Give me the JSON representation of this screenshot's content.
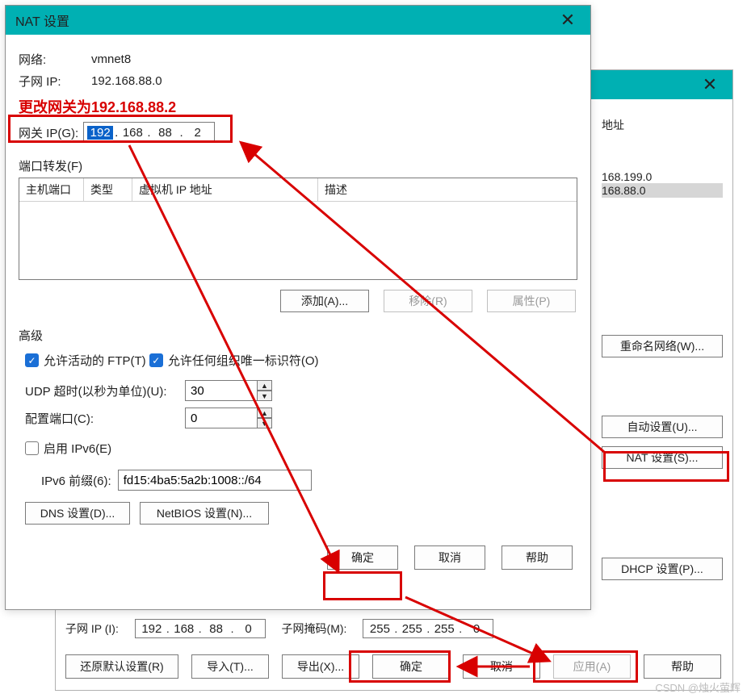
{
  "nat": {
    "title": "NAT 设置",
    "networkLabel": "网络:",
    "networkValue": "vmnet8",
    "subnetIpLabel": "子网 IP:",
    "subnetIpValue": "192.168.88.0",
    "redNote": "更改网关为192.168.88.2",
    "gatewayLabel": "网关 IP(G):",
    "gatewayOctets": {
      "a": "192",
      "b": "168",
      "c": "88",
      "d": "2"
    },
    "portForward": {
      "label": "端口转发(F)",
      "cols": {
        "hostPort": "主机端口",
        "type": "类型",
        "vmIp": "虚拟机 IP 地址",
        "desc": "描述"
      },
      "addBtn": "添加(A)...",
      "removeBtn": "移除(R)",
      "propBtn": "属性(P)"
    },
    "advanced": {
      "label": "高级",
      "ftpLabel": "允许活动的 FTP(T)",
      "ouiLabel": "允许任何组织唯一标识符(O)",
      "udpLabel": "UDP 超时(以秒为单位)(U):",
      "udpValue": "30",
      "cfgPortLabel": "配置端口(C):",
      "cfgPortValue": "0",
      "ipv6Label": "启用 IPv6(E)",
      "ipv6PrefixLabel": "IPv6 前缀(6):",
      "ipv6PrefixValue": "fd15:4ba5:5a2b:1008::/64",
      "dnsBtn": "DNS 设置(D)...",
      "netbiosBtn": "NetBIOS 设置(N)..."
    },
    "footer": {
      "ok": "确定",
      "cancel": "取消",
      "help": "帮助"
    }
  },
  "back": {
    "header": {
      "addr": "地址"
    },
    "rows": {
      "r1": "168.199.0",
      "r2": "168.88.0"
    },
    "renameBtn": "重命名网络(W)...",
    "autoBtn": "自动设置(U)...",
    "natBtn": "NAT 设置(S)...",
    "dhcpBtn": "DHCP 设置(P)...",
    "subnet": {
      "ipLabel": "子网 IP (I):",
      "ip": {
        "a": "192",
        "b": "168",
        "c": "88",
        "d": "0"
      },
      "maskLabel": "子网掩码(M):",
      "mask": {
        "a": "255",
        "b": "255",
        "c": "255",
        "d": "0"
      }
    },
    "bottom": {
      "restore": "还原默认设置(R)",
      "import": "导入(T)...",
      "export": "导出(X)...",
      "ok": "确定",
      "cancel": "取消",
      "apply": "应用(A)",
      "help": "帮助"
    }
  },
  "watermark": "CSDN @烛火萤辉"
}
